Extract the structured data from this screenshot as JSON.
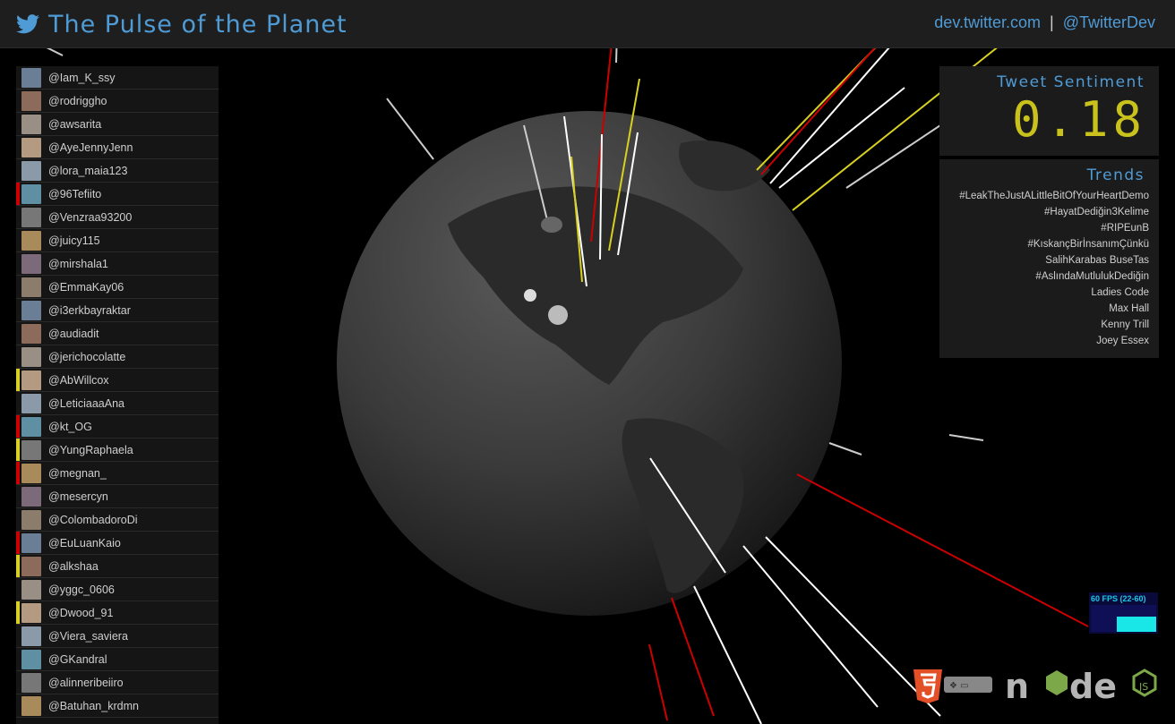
{
  "header": {
    "title": "The Pulse of the Planet",
    "links": [
      "dev.twitter.com",
      "|",
      "@TwitterDev"
    ]
  },
  "colors": {
    "accent": "#4f9bd6",
    "sentiment": "#c9c21d",
    "negative": "#cc0000",
    "neutral": "#ffffff",
    "positive": "#d8d020"
  },
  "users": [
    {
      "handle": "@Iam_K_ssy",
      "mark": "none"
    },
    {
      "handle": "@rodriggho",
      "mark": "none"
    },
    {
      "handle": "@awsarita",
      "mark": "none"
    },
    {
      "handle": "@AyeJennyJenn",
      "mark": "none"
    },
    {
      "handle": "@lora_maia123",
      "mark": "none"
    },
    {
      "handle": "@96Tefiito",
      "mark": "red"
    },
    {
      "handle": "@Venzraa93200",
      "mark": "none"
    },
    {
      "handle": "@juicy115",
      "mark": "none"
    },
    {
      "handle": "@mirshala1",
      "mark": "none"
    },
    {
      "handle": "@EmmaKay06",
      "mark": "none"
    },
    {
      "handle": "@i3erkbayraktar",
      "mark": "none"
    },
    {
      "handle": "@audiadit",
      "mark": "none"
    },
    {
      "handle": "@jerichocolatte",
      "mark": "none"
    },
    {
      "handle": "@AbWillcox",
      "mark": "yellow"
    },
    {
      "handle": "@LeticiaaaAna",
      "mark": "none"
    },
    {
      "handle": "@kt_OG",
      "mark": "red"
    },
    {
      "handle": "@YungRaphaela",
      "mark": "yellow"
    },
    {
      "handle": "@megnan_",
      "mark": "red"
    },
    {
      "handle": "@mesercyn",
      "mark": "none"
    },
    {
      "handle": "@ColombadoroDi",
      "mark": "none"
    },
    {
      "handle": "@EuLuanKaio",
      "mark": "red"
    },
    {
      "handle": "@alkshaa",
      "mark": "yellow"
    },
    {
      "handle": "@yggc_0606",
      "mark": "none"
    },
    {
      "handle": "@Dwood_91",
      "mark": "yellow"
    },
    {
      "handle": "@Viera_saviera",
      "mark": "none"
    },
    {
      "handle": "@GKandral",
      "mark": "none"
    },
    {
      "handle": "@alinneribeiiro",
      "mark": "none"
    },
    {
      "handle": "@Batuhan_krdmn",
      "mark": "none"
    }
  ],
  "sentiment": {
    "title": "Tweet Sentiment",
    "value": "0.18"
  },
  "trends": {
    "title": "Trends",
    "items": [
      "#LeakTheJustALittleBitOfYourHeartDemo",
      "#HayatDediğin3Kelime",
      "#RIPEunB",
      "#KıskançBirİnsanımÇünkü",
      "SalihKarabas BuseTas",
      "#AslındaMutlulukDediğin",
      "Ladies Code",
      "Max Hall",
      "Kenny Trill",
      "Joey Essex"
    ]
  },
  "fps": {
    "label": "60 FPS (22-60)",
    "level": 0.55
  },
  "logos": [
    "html5-logo",
    "node-js-logo"
  ]
}
